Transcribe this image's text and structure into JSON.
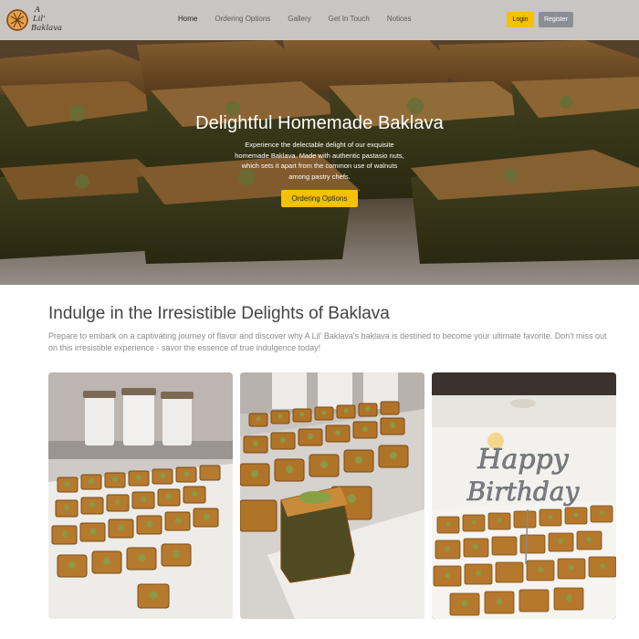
{
  "brand": {
    "line1": "A",
    "line2": "Lil'",
    "line3": "Baklava",
    "icon": "pie-logo-icon"
  },
  "nav": {
    "links": [
      "Home",
      "Ordering Options",
      "Gallery",
      "Get In Touch",
      "Notices"
    ],
    "active": "Home",
    "login_label": "Login",
    "register_label": "Register"
  },
  "hero": {
    "title": "Delightful Homemade Baklava",
    "subtitle": "Experience the delectable delight of our exquisite homemade Baklava. Made with authentic pastasio nuts, which sets it apart from the common use of walnuts among pastry chefs.",
    "cta_label": "Ordering Options"
  },
  "section": {
    "title": "Indulge in the Irresistible Delights of Baklava",
    "description": "Prepare to embark on a captivating journey of flavor and discover why A Lil' Baklava's baklava is destined to become your ultimate favorite. Don't miss out on this irresistible experience - savor the essence of true indulgence today!"
  },
  "gallery": {
    "card3_topper_line1": "Happy",
    "card3_topper_line2": "Birthday"
  },
  "colors": {
    "navbar": "#c9c5c2",
    "accent": "#f7c000",
    "secondary_button": "#8a8f96"
  }
}
